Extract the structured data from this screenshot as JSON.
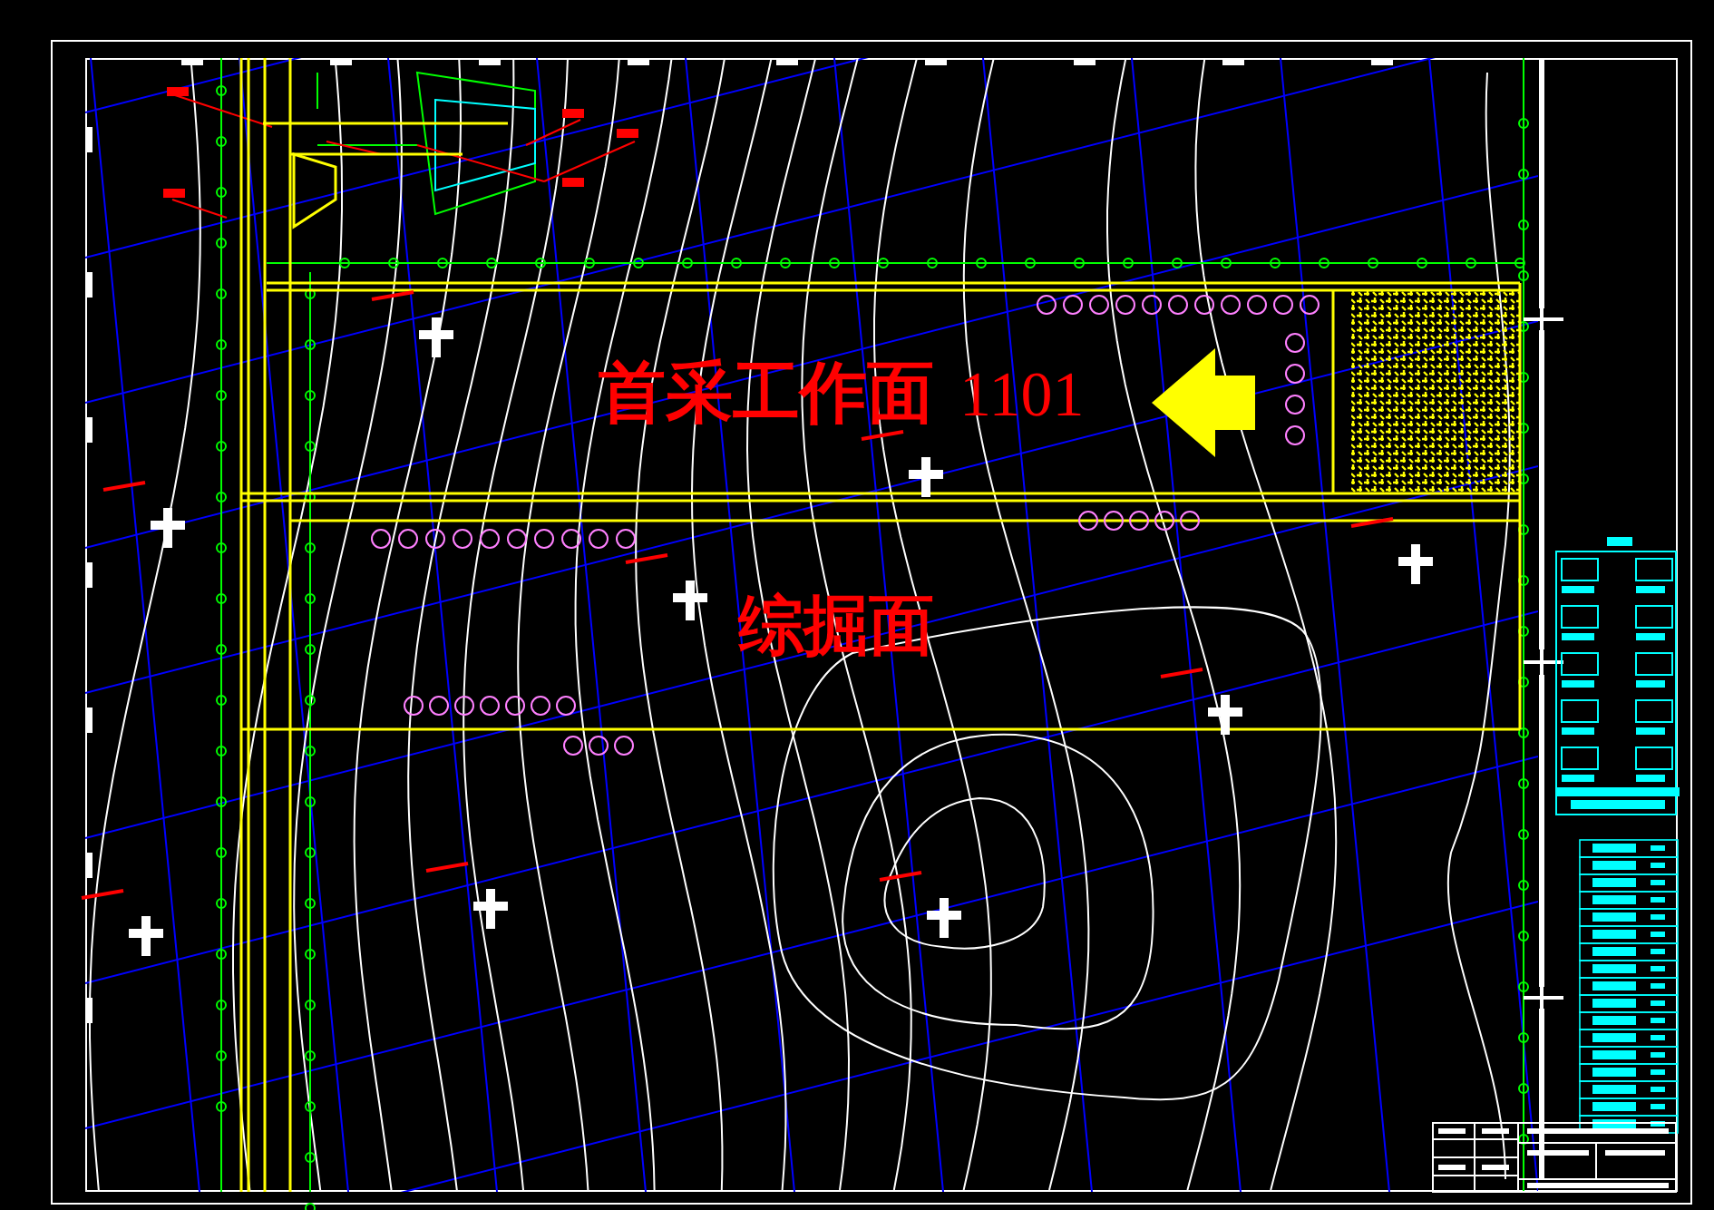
{
  "drawing": {
    "workface_label": {
      "name": "首采工作面",
      "number": "1101"
    },
    "heading_label": "综掘面"
  }
}
